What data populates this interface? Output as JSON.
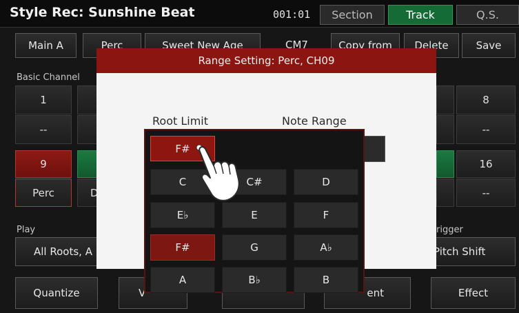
{
  "header": {
    "title": "Style Rec: Sunshine Beat",
    "counter": "001:01",
    "tabs": [
      {
        "label": "Section",
        "active": false
      },
      {
        "label": "Track",
        "active": true
      },
      {
        "label": "Q.S.",
        "active": false
      }
    ]
  },
  "toolbar": {
    "main_a": "Main A",
    "perc": "Perc",
    "sweet_new_age": "Sweet New Age",
    "chord": "CM7",
    "copy_from": "Copy from",
    "delete": "Delete",
    "save": "Save"
  },
  "basic_channel": {
    "label": "Basic Channel",
    "ch1": {
      "number": "1",
      "value": "--"
    },
    "ch8": {
      "number": "8",
      "value": "--"
    },
    "ch9": {
      "number": "9",
      "value": "Perc"
    },
    "ch16": {
      "number": "16",
      "value": "--"
    },
    "partial_letter": "D"
  },
  "play": {
    "label": "Play",
    "value": "All Roots, A"
  },
  "trigger": {
    "label": "rigger",
    "value": "Pitch Shift"
  },
  "bottom": {
    "quantize": "Quantize",
    "velocity_partial": "V",
    "movement_partial": "ent",
    "effect": "Effect"
  },
  "dialog": {
    "title": "Range Setting: Perc, CH09",
    "root_limit_label": "Root Limit",
    "note_range_label": "Note Range",
    "root_limit_value": "F#"
  },
  "note_picker": {
    "keys": [
      "C",
      "C#",
      "D",
      "E♭",
      "E",
      "F",
      "F#",
      "G",
      "A♭",
      "A",
      "B♭",
      "B"
    ],
    "selected": "F#"
  }
}
